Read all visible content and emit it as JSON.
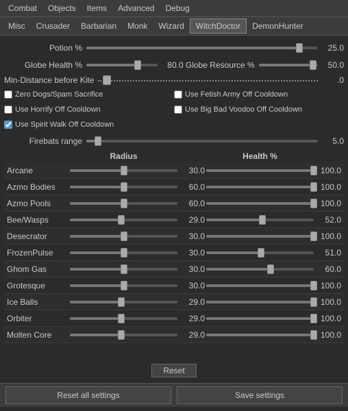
{
  "menu": {
    "items": [
      "Combat",
      "Objects",
      "Items",
      "Advanced",
      "Debug"
    ]
  },
  "tabs": {
    "items": [
      "Misc",
      "Crusader",
      "Barbarian",
      "Monk",
      "Wizard",
      "WitchDoctor",
      "DemonHunter"
    ],
    "active": "WitchDoctor"
  },
  "sliders": {
    "potion": {
      "label": "Potion %",
      "value": "25.0",
      "fill_pct": 92
    },
    "globe_health": {
      "label": "Globe Health %",
      "value": "80.0",
      "fill_pct": 72,
      "thumb_pct": 72
    },
    "globe_resource": {
      "label": "Globe Resource %",
      "value": "50.0",
      "fill_pct": 92,
      "thumb_pct": 92
    },
    "min_distance": {
      "label": "Min-Distance before Kite",
      "value": ".0"
    },
    "firebats": {
      "label": "Firebats range",
      "value": "5.0",
      "fill_pct": 5,
      "thumb_pct": 5
    }
  },
  "checkboxes": {
    "zero_dogs": {
      "label": "Zero Dogs/Spam Sacrifice",
      "checked": false
    },
    "use_fetish_army": {
      "label": "Use Fetish Army Off Cooldown",
      "checked": false
    },
    "use_horrify": {
      "label": "Use Horrify Off Cooldown",
      "checked": false
    },
    "use_big_bad": {
      "label": "Use Big Bad Voodoo Off Cooldown",
      "checked": false
    },
    "use_spirit_walk": {
      "label": "Use Spirit Walk Off Cooldown",
      "checked": true
    }
  },
  "table": {
    "header": {
      "radius": "Radius",
      "health": "Health %"
    },
    "rows": [
      {
        "name": "Arcane",
        "radius": "30.0",
        "radius_pct": 50,
        "health": "100.0",
        "health_pct": 100
      },
      {
        "name": "Azmo Bodies",
        "radius": "60.0",
        "radius_pct": 50,
        "health": "100.0",
        "health_pct": 100
      },
      {
        "name": "Azmo Pools",
        "radius": "60.0",
        "radius_pct": 50,
        "health": "100.0",
        "health_pct": 100
      },
      {
        "name": "Bee/Wasps",
        "radius": "29.0",
        "radius_pct": 48,
        "health": "52.0",
        "health_pct": 52
      },
      {
        "name": "Desecrator",
        "radius": "30.0",
        "radius_pct": 50,
        "health": "100.0",
        "health_pct": 100
      },
      {
        "name": "FrozenPulse",
        "radius": "30.0",
        "radius_pct": 50,
        "health": "51.0",
        "health_pct": 51
      },
      {
        "name": "Ghom Gas",
        "radius": "30.0",
        "radius_pct": 50,
        "health": "60.0",
        "health_pct": 60
      },
      {
        "name": "Grotesque",
        "radius": "30.0",
        "radius_pct": 50,
        "health": "100.0",
        "health_pct": 100
      },
      {
        "name": "Ice Balls",
        "radius": "29.0",
        "radius_pct": 48,
        "health": "100.0",
        "health_pct": 100
      },
      {
        "name": "Orbiter",
        "radius": "29.0",
        "radius_pct": 48,
        "health": "100.0",
        "health_pct": 100
      },
      {
        "name": "Molten Core",
        "radius": "29.0",
        "radius_pct": 48,
        "health": "100.0",
        "health_pct": 100
      }
    ]
  },
  "buttons": {
    "reset": "Reset",
    "reset_all": "Reset all settings",
    "save": "Save settings"
  }
}
